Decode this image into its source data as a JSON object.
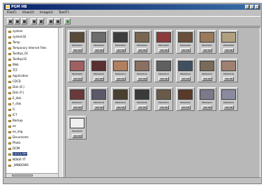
{
  "window": {
    "title": "PGM HB"
  },
  "menu": [
    "File(F)",
    "View(V)",
    "Image(I)",
    "Tool(T)"
  ],
  "toolbar": {
    "buttons": [
      "tool-1",
      "tool-2",
      "tool-3",
      "tool-4",
      "tool-5",
      "tool-6",
      "tool-7",
      "refresh"
    ]
  },
  "tree": {
    "items": [
      "system",
      "system32",
      "Temp",
      "Temporary Internet Files",
      "Tooltips_01",
      "Tooltips32",
      "Web",
      "TCF",
      "Application",
      "CDCD",
      "Disk (E:)",
      "Disk (F:)",
      "E_disk",
      "F_disk",
      "G",
      "ICT",
      "Backup",
      "ex",
      "ex_img",
      "Documents",
      "Photo",
      "DCIM",
      "100OLYMP",
      "NOKIA YT",
      "_WINDOWS"
    ],
    "selected_index": 22
  },
  "gallery": {
    "tiles": [
      {
        "name": "P6010001",
        "size": "160 KB",
        "color": "#5a4a3a"
      },
      {
        "name": "P6010002",
        "size": "160 KB",
        "color": "#6d6d6d"
      },
      {
        "name": "P6010003",
        "size": "160 KB",
        "color": "#3d3d3d"
      },
      {
        "name": "P6010004",
        "size": "160 KB",
        "color": "#7a6650"
      },
      {
        "name": "P6010005",
        "size": "160 KB",
        "color": "#8c3a3a"
      },
      {
        "name": "P6010006",
        "size": "160 KB",
        "color": "#6a4e3a"
      },
      {
        "name": "P6010007",
        "size": "160 KB",
        "color": "#9a7a5a"
      },
      {
        "name": "P6010008",
        "size": "160 KB",
        "color": "#b0a080"
      },
      {
        "name": "P6010009",
        "size": "160 KB",
        "color": "#a06060"
      },
      {
        "name": "P6010010",
        "size": "160 KB",
        "color": "#5a3030"
      },
      {
        "name": "P6010011",
        "size": "160 KB",
        "color": "#b08060"
      },
      {
        "name": "P6010012",
        "size": "160 KB",
        "color": "#8a7060"
      },
      {
        "name": "P6010013",
        "size": "160 KB",
        "color": "#606060"
      },
      {
        "name": "P6010014",
        "size": "160 KB",
        "color": "#405060"
      },
      {
        "name": "P6010015",
        "size": "160 KB",
        "color": "#7a6a5a"
      },
      {
        "name": "P6010016",
        "size": "160 KB",
        "color": "#a08070"
      },
      {
        "name": "P6010017",
        "size": "160 KB",
        "color": "#6a3a3a"
      },
      {
        "name": "P6010018",
        "size": "160 KB",
        "color": "#5a5a6a"
      },
      {
        "name": "P6010019",
        "size": "160 KB",
        "color": "#4a4030"
      },
      {
        "name": "P6010020",
        "size": "160 KB",
        "color": "#3a3a3a"
      },
      {
        "name": "P6010021",
        "size": "160 KB",
        "color": "#6a5a4a"
      },
      {
        "name": "P6010022",
        "size": "160 KB",
        "color": "#5a3a2a"
      },
      {
        "name": "P6010023",
        "size": "160 KB",
        "color": "#7a7a8a"
      },
      {
        "name": "P6010024",
        "size": "160 KB",
        "color": "#8a8aa0"
      },
      {
        "name": "P6010025",
        "size": "160 KB",
        "color": "#f0f0f0"
      }
    ]
  }
}
